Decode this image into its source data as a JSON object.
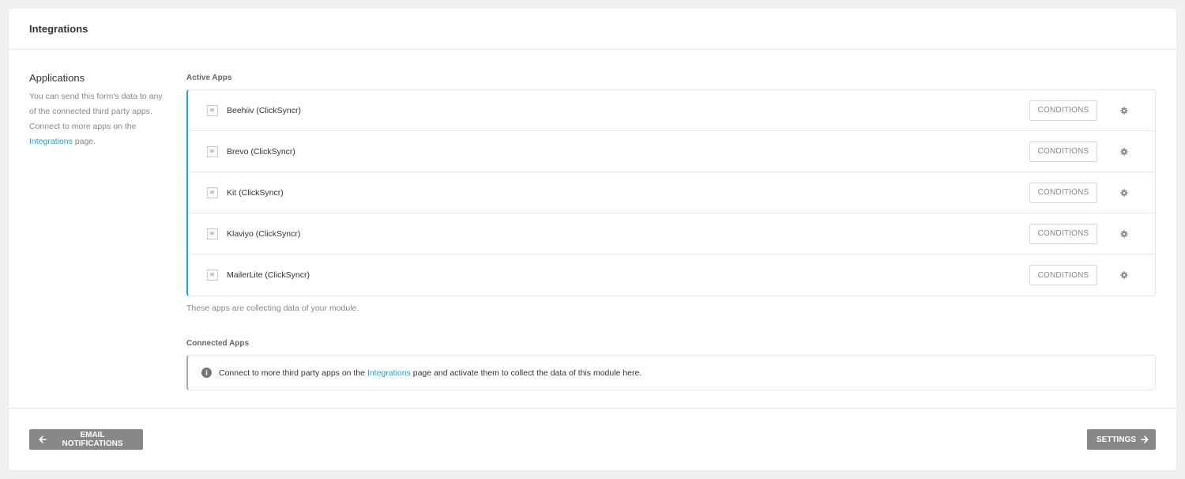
{
  "header": {
    "title": "Integrations"
  },
  "sidebar": {
    "title": "Applications",
    "desc_before": "You can send this form's data to any of the connected third party apps. Connect to more apps on the ",
    "link": "Integrations",
    "desc_after": " page."
  },
  "active_apps": {
    "label": "Active Apps",
    "items": [
      {
        "name": "Beehiiv (ClickSyncr)",
        "conditions": "CONDITIONS",
        "icon": "broken-image-icon"
      },
      {
        "name": "Brevo (ClickSyncr)",
        "conditions": "CONDITIONS",
        "icon": "broken-image-icon"
      },
      {
        "name": "Kit (ClickSyncr)",
        "conditions": "CONDITIONS",
        "icon": "broken-image-icon"
      },
      {
        "name": "Klaviyo (ClickSyncr)",
        "conditions": "CONDITIONS",
        "icon": "broken-image-icon"
      },
      {
        "name": "MailerLite (ClickSyncr)",
        "conditions": "CONDITIONS",
        "icon": "broken-image-icon"
      }
    ],
    "help": "These apps are collecting data of your module."
  },
  "connected_apps": {
    "label": "Connected Apps",
    "text_before": "Connect to more third party apps on the ",
    "link": "Integrations",
    "text_after": " page and activate them to collect the data of this module here."
  },
  "footer": {
    "back_label": "EMAIL NOTIFICATIONS",
    "next_label": "SETTINGS"
  },
  "colors": {
    "accent": "#17a8e3",
    "nav_button": "#888888",
    "border": "#e6e6e6",
    "background": "#f0f0f0"
  }
}
